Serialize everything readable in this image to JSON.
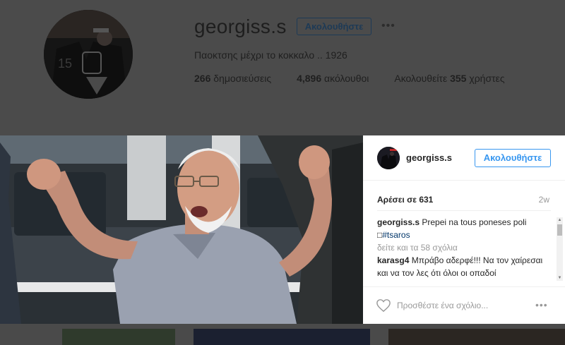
{
  "profile": {
    "username": "georgiss.s",
    "follow_label": "Ακολουθήστε",
    "more_icon": "ellipsis-icon",
    "bio": "Παοκτσης μέχρι το κοκκαλο .. 1926",
    "stats": {
      "posts_count": "266",
      "posts_label": "δημοσιεύσεις",
      "followers_count": "4,896",
      "followers_label": "ακόλουθοι",
      "following_prefix": "Ακολουθείτε",
      "following_count": "355",
      "following_suffix": "χρήστες"
    }
  },
  "post": {
    "author": "georgiss.s",
    "follow_label": "Ακολουθήστε",
    "likes_text": "Αρέσει σε 631",
    "time_ago": "2w",
    "caption_user": "georgiss.s",
    "caption_text": "Prepei na tous poneses poli",
    "caption_glyph": "□",
    "caption_tag": "#tsaros",
    "view_more_comments": "δείτε και τα 58 σχόλια",
    "comments": [
      {
        "user": "karasg4",
        "text": "Μπράβο αδερφέ!!! Να τον χαίρεσαι και να τον λες ότι όλοι οι οπαδοί"
      }
    ],
    "comment_placeholder": "Προσθέστε ένα σχόλιο...",
    "icons": {
      "like": "heart-icon",
      "options": "ellipsis-icon"
    }
  },
  "colors": {
    "overlay_bg": "#4b4b4b",
    "link_blue": "#3897f0",
    "hashtag": "#003569"
  }
}
